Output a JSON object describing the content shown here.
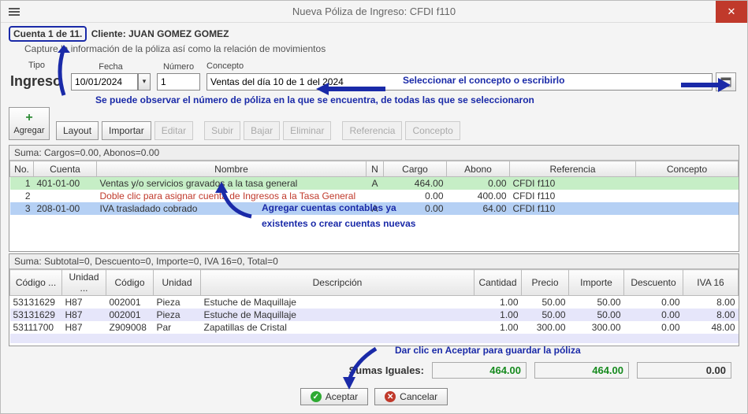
{
  "window": {
    "title": "Nueva Póliza de Ingreso: CFDI f110"
  },
  "header": {
    "counter": "Cuenta 1 de 11.",
    "client_label": "Cliente: JUAN GOMEZ GOMEZ",
    "subtitle": "Capture la información de la póliza así como la relación de movimientos"
  },
  "form": {
    "tipo_label": "Tipo",
    "tipo_value": "Ingreso",
    "fecha_label": "Fecha",
    "fecha_value": "10/01/2024",
    "numero_label": "Número",
    "numero_value": "1",
    "concepto_label": "Concepto",
    "concepto_value": "Ventas del día 10 de 1 del 2024"
  },
  "annotations": {
    "concepto_select": "Seleccionar el concepto o escribirlo",
    "counter_note": "Se puede observar el número de póliza en la que se encuentra, de todas las que se seleccionaron",
    "account_add": "Agregar cuentas contables ya",
    "account_add2": "existentes o crear cuentas nuevas",
    "accept_note": "Dar clic en Aceptar para guardar la póliza"
  },
  "toolbar": {
    "agregar": "Agregar",
    "layout": "Layout",
    "importar": "Importar",
    "editar": "Editar",
    "subir": "Subir",
    "bajar": "Bajar",
    "eliminar": "Eliminar",
    "referencia": "Referencia",
    "concepto": "Concepto"
  },
  "grid1": {
    "summary": "Suma:  Cargos=0.00, Abonos=0.00",
    "cols": {
      "no": "No.",
      "cuenta": "Cuenta",
      "nombre": "Nombre",
      "n": "N",
      "cargo": "Cargo",
      "abono": "Abono",
      "referencia": "Referencia",
      "concepto": "Concepto"
    },
    "rows": [
      {
        "no": "1",
        "cuenta": "401-01-00",
        "nombre": "Ventas y/o servicios gravados a la tasa general",
        "n": "A",
        "cargo": "464.00",
        "abono": "0.00",
        "ref": "CFDI f110"
      },
      {
        "no": "2",
        "cuenta": "",
        "nombre": "Doble clic para asignar cuenta de Ingresos a la Tasa General",
        "n": "",
        "cargo": "0.00",
        "abono": "400.00",
        "ref": "CFDI f110",
        "red": true
      },
      {
        "no": "3",
        "cuenta": "208-01-00",
        "nombre": "IVA trasladado cobrado",
        "n": "A",
        "cargo": "0.00",
        "abono": "64.00",
        "ref": "CFDI f110"
      }
    ]
  },
  "grid2": {
    "summary": "Suma:  Subtotal=0, Descuento=0, Importe=0, IVA 16=0, Total=0",
    "cols": {
      "codigo": "Código ...",
      "unidad_k": "Unidad ...",
      "codigo2": "Código",
      "unidad": "Unidad",
      "descripcion": "Descripción",
      "cantidad": "Cantidad",
      "precio": "Precio",
      "importe": "Importe",
      "descuento": "Descuento",
      "iva16": "IVA 16"
    },
    "rows": [
      {
        "codigo": "53131629",
        "unidad_k": "H87",
        "codigo2": "002001",
        "unidad": "Pieza",
        "desc": "Estuche de Maquillaje",
        "cant": "1.00",
        "precio": "50.00",
        "importe": "50.00",
        "descuento": "0.00",
        "iva16": "8.00"
      },
      {
        "codigo": "53131629",
        "unidad_k": "H87",
        "codigo2": "002001",
        "unidad": "Pieza",
        "desc": "Estuche de Maquillaje",
        "cant": "1.00",
        "precio": "50.00",
        "importe": "50.00",
        "descuento": "0.00",
        "iva16": "8.00"
      },
      {
        "codigo": "53111700",
        "unidad_k": "H87",
        "codigo2": "Z909008",
        "unidad": "Par",
        "desc": "Zapatillas de Cristal",
        "cant": "1.00",
        "precio": "300.00",
        "importe": "300.00",
        "descuento": "0.00",
        "iva16": "48.00"
      }
    ]
  },
  "totals": {
    "label": "Sumas Iguales:",
    "cargo": "464.00",
    "abono": "464.00",
    "diff": "0.00"
  },
  "buttons": {
    "aceptar": "Aceptar",
    "cancelar": "Cancelar"
  }
}
